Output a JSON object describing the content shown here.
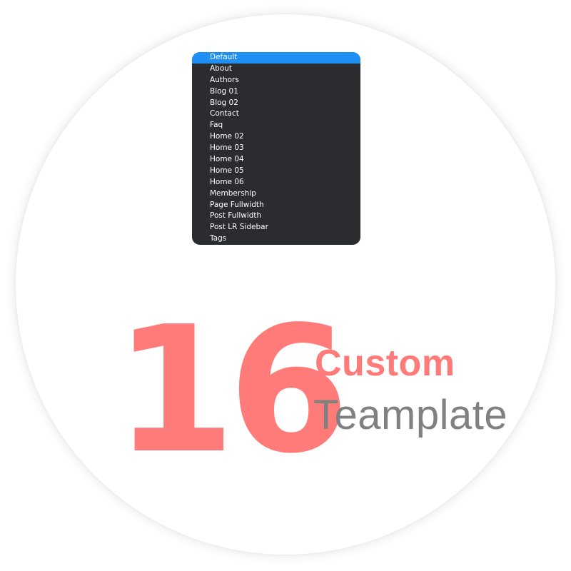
{
  "dropdown": {
    "selected": "Default",
    "options": [
      {
        "label": "Default",
        "selected": true
      },
      {
        "label": "About",
        "selected": false
      },
      {
        "label": "Authors",
        "selected": false
      },
      {
        "label": "Blog 01",
        "selected": false
      },
      {
        "label": "Blog 02",
        "selected": false
      },
      {
        "label": "Contact",
        "selected": false
      },
      {
        "label": "Faq",
        "selected": false
      },
      {
        "label": "Home 02",
        "selected": false
      },
      {
        "label": "Home 03",
        "selected": false
      },
      {
        "label": "Home 04",
        "selected": false
      },
      {
        "label": "Home 05",
        "selected": false
      },
      {
        "label": "Home 06",
        "selected": false
      },
      {
        "label": "Membership",
        "selected": false
      },
      {
        "label": "Page Fullwidth",
        "selected": false
      },
      {
        "label": "Post Fullwidth",
        "selected": false
      },
      {
        "label": "Post LR Sidebar",
        "selected": false
      },
      {
        "label": "Tags",
        "selected": false
      }
    ]
  },
  "headline": {
    "number": "16",
    "word1": "Custom",
    "word2": "Teamplate"
  },
  "colors": {
    "accent": "#ff7b79",
    "secondary_text": "#808080",
    "dropdown_bg": "#2b2c30",
    "dropdown_selected": "#1e90f5"
  }
}
